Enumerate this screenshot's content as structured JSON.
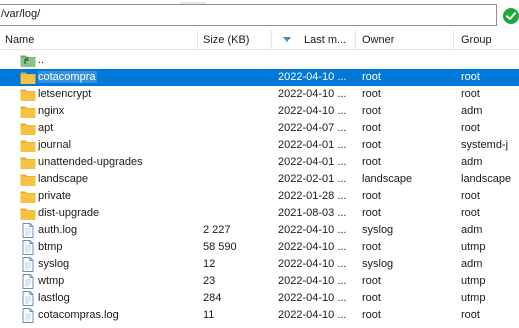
{
  "path": {
    "value": "/var/log/"
  },
  "columns": [
    "Name",
    "Size (KB)",
    "Last m...",
    "Owner",
    "Group"
  ],
  "rows": [
    {
      "icon": "parent-folder-icon",
      "name": "..",
      "size": "",
      "modified": "",
      "owner": "",
      "group": ""
    },
    {
      "icon": "folder-icon",
      "name": "cotacompra",
      "size": "",
      "modified": "2022-04-10 ...",
      "owner": "root",
      "group": "root",
      "selected": true
    },
    {
      "icon": "folder-icon",
      "name": "letsencrypt",
      "size": "",
      "modified": "2022-04-10 ...",
      "owner": "root",
      "group": "root"
    },
    {
      "icon": "folder-icon",
      "name": "nginx",
      "size": "",
      "modified": "2022-04-10 ...",
      "owner": "root",
      "group": "adm"
    },
    {
      "icon": "folder-icon",
      "name": "apt",
      "size": "",
      "modified": "2022-04-07 ...",
      "owner": "root",
      "group": "root"
    },
    {
      "icon": "folder-icon",
      "name": "journal",
      "size": "",
      "modified": "2022-04-01 ...",
      "owner": "root",
      "group": "systemd-j"
    },
    {
      "icon": "folder-icon",
      "name": "unattended-upgrades",
      "size": "",
      "modified": "2022-04-01 ...",
      "owner": "root",
      "group": "adm"
    },
    {
      "icon": "folder-icon",
      "name": "landscape",
      "size": "",
      "modified": "2022-02-01 ...",
      "owner": "landscape",
      "group": "landscape"
    },
    {
      "icon": "folder-icon",
      "name": "private",
      "size": "",
      "modified": "2022-01-28 ...",
      "owner": "root",
      "group": "root"
    },
    {
      "icon": "folder-icon",
      "name": "dist-upgrade",
      "size": "",
      "modified": "2021-08-03 ...",
      "owner": "root",
      "group": "root"
    },
    {
      "icon": "file-icon",
      "name": "auth.log",
      "size": "2 227",
      "modified": "2022-04-10 ...",
      "owner": "syslog",
      "group": "adm"
    },
    {
      "icon": "file-icon",
      "name": "btmp",
      "size": "58 590",
      "modified": "2022-04-10 ...",
      "owner": "root",
      "group": "utmp"
    },
    {
      "icon": "file-icon",
      "name": "syslog",
      "size": "12",
      "modified": "2022-04-10 ...",
      "owner": "syslog",
      "group": "adm"
    },
    {
      "icon": "file-icon",
      "name": "wtmp",
      "size": "23",
      "modified": "2022-04-10 ...",
      "owner": "root",
      "group": "utmp"
    },
    {
      "icon": "file-icon",
      "name": "lastlog",
      "size": "284",
      "modified": "2022-04-10 ...",
      "owner": "root",
      "group": "utmp"
    },
    {
      "icon": "file-icon",
      "name": "cotacompras.log",
      "size": "11",
      "modified": "2022-04-10 ...",
      "owner": "root",
      "group": "root"
    }
  ],
  "colors": {
    "selection": "#0078d7",
    "folder": "#f5c342",
    "ok": "#1fa83b"
  }
}
